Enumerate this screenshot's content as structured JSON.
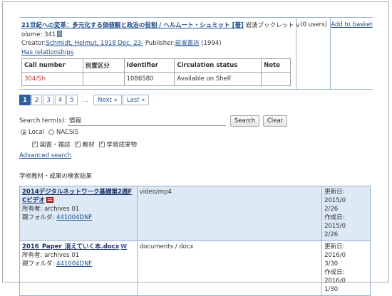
{
  "record": {
    "title": "21世紀への変革：多元化する価値観と政治の役割 / ヘルムート・シュミット [著]",
    "title_tail": "岩波ブックレット v",
    "volume_line": "olume: 341",
    "creator_label": "Creator:",
    "creator": "Schmidt, Helmut, 1918 Dec. 23-",
    "publisher_label": "Publisher:",
    "publisher": "岩波書店",
    "year": "(1994)",
    "relationships": "Has relationships",
    "users": "(0 users)",
    "add_basket": "Add to basket",
    "holdings_headers": [
      "Call number",
      "別置区分",
      "Identifier",
      "Circulation status",
      "Note"
    ],
    "holdings_row": [
      "304/Sh",
      "",
      "1086580",
      "Available on Shelf",
      ""
    ]
  },
  "pager": {
    "pages": [
      "1",
      "2",
      "3",
      "4",
      "5"
    ],
    "active": "1",
    "ellipsis": "…",
    "next": "Next »",
    "last": "Last »"
  },
  "search": {
    "label": "Search term(s):",
    "value": "情報",
    "search_btn": "Search",
    "clear_btn": "Clear",
    "scope_local": "Local",
    "scope_nacsis": "NACSIS",
    "check_1": "図書・雑誌",
    "check_2": "教材",
    "check_3": "学習成果物",
    "advanced": "Advanced search"
  },
  "section_title": "学修教材・成果の検索結果",
  "results": [
    {
      "title_l1": "2014デジタルネットワーク基礎第2週F",
      "title_l2": "Cビデオ",
      "owner": "所有者: archives 01",
      "folder_label": "親フォルダ:",
      "folder": "441004DNF",
      "mime": "video/mp4",
      "upd_l1": "更新日: 2015/0",
      "upd_l2": "2/26",
      "cre_l1": "作成日: 2015/0",
      "cre_l2": "2/26",
      "icon": "video-icon"
    },
    {
      "title_l1": "2016_Paper_消えていく本.docx",
      "owner": "所有者: archives 01",
      "folder_label": "親フォルダ:",
      "folder": "441004DNF",
      "mime": "documents / docx",
      "upd_l1": "更新日: 2016/0",
      "upd_l2": "3/30",
      "cre_l1": "作成日: 2016/0",
      "cre_l2": "1/30",
      "icon": "word-doc-icon"
    }
  ],
  "colors": {
    "link": "#1a4d8c",
    "call_number": "#c0392b",
    "pager_active": "#2b5f9e",
    "row_highlight": "#dde9f5"
  }
}
